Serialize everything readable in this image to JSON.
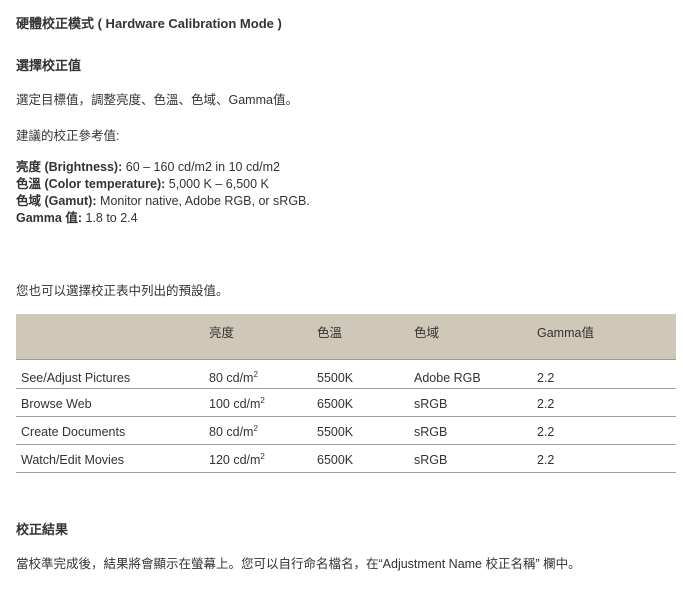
{
  "title": "硬體校正模式 ( Hardware Calibration Mode )",
  "select_section": {
    "heading": "選擇校正值",
    "instruction": "選定目標值，調整亮度、色溫、色域、Gamma值。",
    "recommend_intro": "建議的校正參考值:"
  },
  "specs": [
    {
      "label": "亮度 (Brightness):",
      "value": " 60 – 160 cd/m2 in 10 cd/m2"
    },
    {
      "label": "色溫 (Color temperature):",
      "value": " 5,000 K – 6,500 K"
    },
    {
      "label": "色域 (Gamut):",
      "value": " Monitor native, Adobe RGB, or sRGB."
    },
    {
      "label": "Gamma 值:",
      "value": " 1.8 to 2.4"
    }
  ],
  "preset_intro": "您也可以選擇校正表中列出的預設值。",
  "table": {
    "headers": [
      "",
      "亮度",
      "色溫",
      "色域",
      "Gamma值"
    ],
    "rows": [
      {
        "use": "See/Adjust Pictures",
        "brightness": "80 cd/m",
        "sup": "2",
        "temp": "5500K",
        "gamut": "Adobe RGB",
        "gamma": "2.2"
      },
      {
        "use": "Browse Web",
        "brightness": "100 cd/m",
        "sup": "2",
        "temp": "6500K",
        "gamut": "sRGB",
        "gamma": "2.2"
      },
      {
        "use": "Create Documents",
        "brightness": "80 cd/m",
        "sup": "2",
        "temp": "5500K",
        "gamut": "sRGB",
        "gamma": "2.2"
      },
      {
        "use": "Watch/Edit Movies",
        "brightness": "120 cd/m",
        "sup": "2",
        "temp": "6500K",
        "gamut": "sRGB",
        "gamma": "2.2"
      }
    ]
  },
  "result_section": {
    "heading": "校正結果",
    "text": "當校準完成後，結果將會顯示在螢幕上。您可以自行命名檔名，在“Adjustment Name 校正名稱” 欄中。"
  }
}
